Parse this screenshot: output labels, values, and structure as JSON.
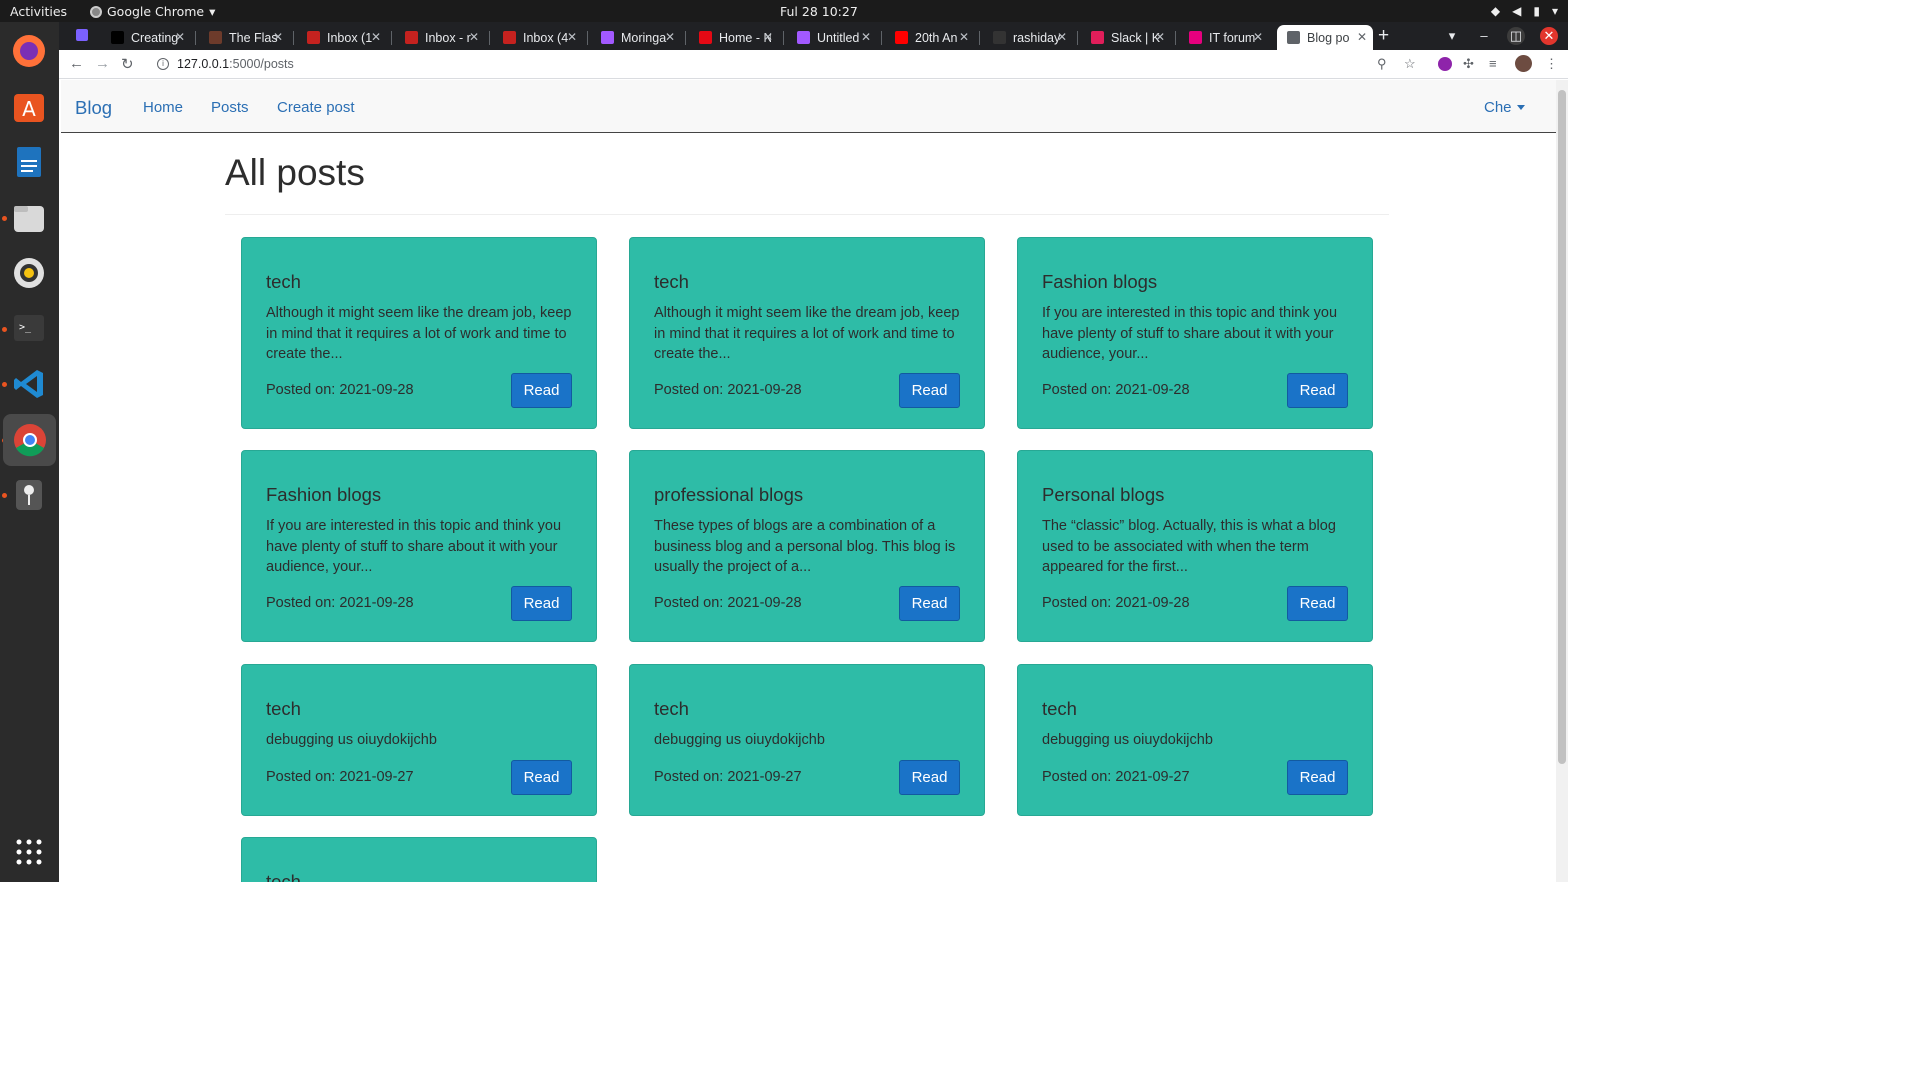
{
  "system": {
    "activities": "Activities",
    "app_name": "Google Chrome",
    "clock": "Ful 28  10:27"
  },
  "browser": {
    "tabs": [
      {
        "label": "Creating",
        "favicon_color": "#000000"
      },
      {
        "label": "The Flas",
        "favicon_color": "#6d3b2b"
      },
      {
        "label": "Inbox (1",
        "favicon_color": "#c5221f"
      },
      {
        "label": "Inbox - r",
        "favicon_color": "#c5221f"
      },
      {
        "label": "Inbox (4",
        "favicon_color": "#c5221f"
      },
      {
        "label": "Moringa",
        "favicon_color": "#a259ff"
      },
      {
        "label": "Home - N",
        "favicon_color": "#e50914"
      },
      {
        "label": "Untitled",
        "favicon_color": "#a259ff"
      },
      {
        "label": "20th An",
        "favicon_color": "#ff0000"
      },
      {
        "label": "rashiday",
        "favicon_color": "#333333"
      },
      {
        "label": "Slack | K",
        "favicon_color": "#e01e5a"
      },
      {
        "label": "IT forum",
        "favicon_color": "#e6007e"
      },
      {
        "label": "Blog po",
        "favicon_color": "#5f6368"
      }
    ],
    "url_host": "127.0.0.1",
    "url_path": ":5000/posts"
  },
  "navbar": {
    "brand": "Blog",
    "links": [
      "Home",
      "Posts",
      "Create post"
    ],
    "user": "Che"
  },
  "page": {
    "title": "All posts",
    "read_label": "Read",
    "posted_prefix": "Posted on: ",
    "posts": [
      {
        "title": "tech",
        "excerpt": "Although it might seem like the dream job, keep in mind that it requires a lot of work and time to create the...",
        "date": "2021-09-28"
      },
      {
        "title": "tech",
        "excerpt": "Although it might seem like the dream job, keep in mind that it requires a lot of work and time to create the...",
        "date": "2021-09-28"
      },
      {
        "title": "Fashion blogs",
        "excerpt": "If you are interested in this topic and think you have plenty of stuff to share about it with your audience, your...",
        "date": "2021-09-28"
      },
      {
        "title": "Fashion blogs",
        "excerpt": "If you are interested in this topic and think you have plenty of stuff to share about it with your audience, your...",
        "date": "2021-09-28"
      },
      {
        "title": "professional blogs",
        "excerpt": "These types of blogs are a combination of a business blog and a personal blog. This blog is usually the project of a...",
        "date": "2021-09-28"
      },
      {
        "title": "Personal blogs",
        "excerpt": "The “classic” blog. Actually, this is what a blog used to be associated with when the term appeared for the first...",
        "date": "2021-09-28"
      },
      {
        "title": "tech",
        "excerpt": "debugging us oiuydokijchb",
        "date": "2021-09-27"
      },
      {
        "title": "tech",
        "excerpt": "debugging us oiuydokijchb",
        "date": "2021-09-27"
      },
      {
        "title": "tech",
        "excerpt": "debugging us oiuydokijchb",
        "date": "2021-09-27"
      },
      {
        "title": "tech",
        "excerpt": "",
        "date": ""
      }
    ]
  },
  "colors": {
    "card": "#2ebca7",
    "button": "#1a73c8",
    "link": "#2b6fb4"
  }
}
